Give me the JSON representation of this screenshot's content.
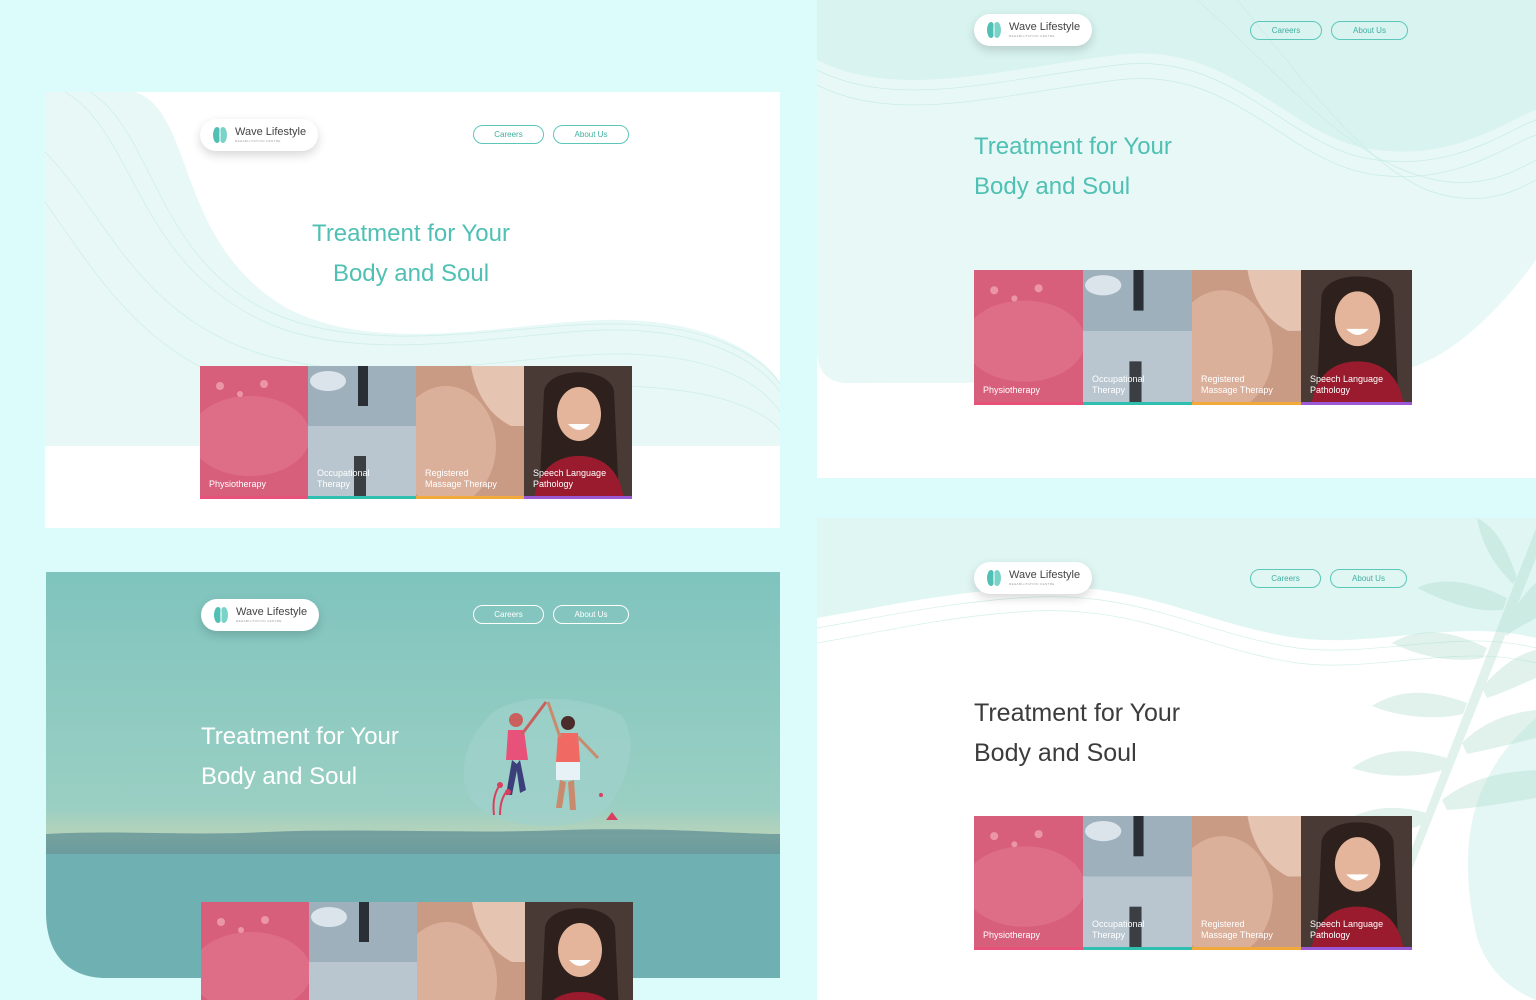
{
  "brand": {
    "name": "Wave Lifestyle",
    "subtitle": "REHABILITATION CENTRE"
  },
  "nav": {
    "careers": "Careers",
    "about": "About Us"
  },
  "hero": {
    "line1": "Treatment for Your",
    "line2": "Body and Soul"
  },
  "services": [
    {
      "line1": "",
      "line2": "Physiotherapy",
      "bar": "#e8527a"
    },
    {
      "line1": "Occupational",
      "line2": "Therapy",
      "bar": "#2fbfb1"
    },
    {
      "line1": "Registered",
      "line2": "Massage Therapy",
      "bar": "#f2a93b"
    },
    {
      "line1": "Speech Language",
      "line2": "Pathology",
      "bar": "#9b59d6"
    }
  ],
  "colors": {
    "accent": "#4fc0b3",
    "background": "#dcfcfb",
    "teal_panel": "#7fc4be"
  }
}
